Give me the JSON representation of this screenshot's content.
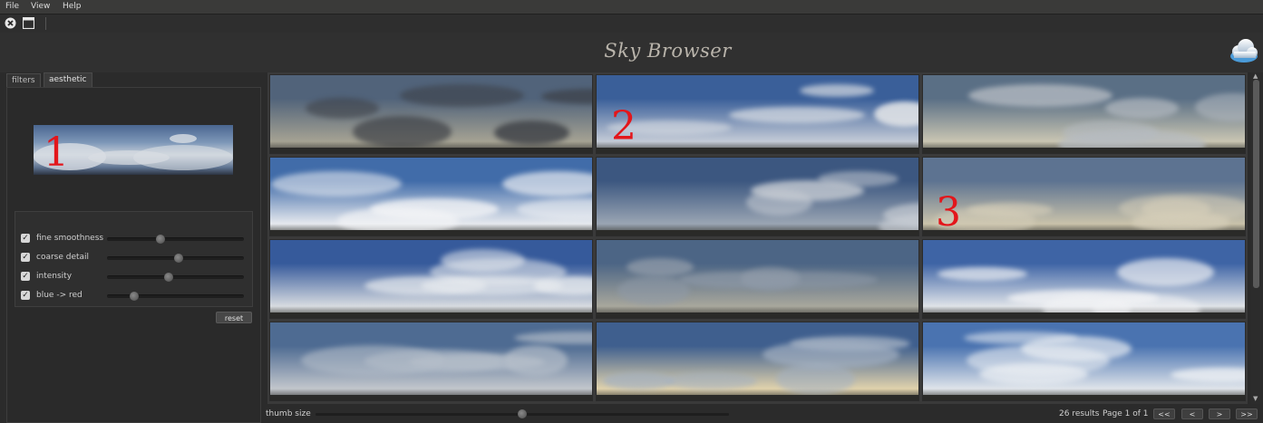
{
  "menu": {
    "file": "File",
    "view": "View",
    "help": "Help"
  },
  "toolbar": {
    "close_icon": "close-circle-icon",
    "window_icon": "window-icon"
  },
  "header": {
    "title": "Sky Browser",
    "logo_icon": "cloud-icon"
  },
  "tabs": [
    {
      "label": "filters",
      "active": false
    },
    {
      "label": "aesthetic",
      "active": true
    }
  ],
  "preview": {
    "marker": "1"
  },
  "sliders": [
    {
      "label": "fine smoothness",
      "checked": true,
      "value": 0.39
    },
    {
      "label": "coarse detail",
      "checked": true,
      "value": 0.52
    },
    {
      "label": "intensity",
      "checked": true,
      "value": 0.45
    },
    {
      "label": "blue -> red",
      "checked": true,
      "value": 0.2
    }
  ],
  "reset_label": "reset",
  "grid": {
    "markers": [
      "2",
      "3"
    ],
    "thumbnails": [
      {
        "sky": "#51637a",
        "horizon": "#a5a293",
        "cloud": "#3b3e44"
      },
      {
        "sky": "#3a5f99",
        "horizon": "#c3cad6",
        "cloud": "#dfe2e6"
      },
      {
        "sky": "#5a6f85",
        "horizon": "#c9c5b2",
        "cloud": "#b5bbc2"
      },
      {
        "sky": "#416ca9",
        "horizon": "#e6e9ee",
        "cloud": "#f3f4f6"
      },
      {
        "sky": "#3c5780",
        "horizon": "#9aa5b3",
        "cloud": "#c8cdd4"
      },
      {
        "sky": "#5d7391",
        "horizon": "#c9c2aa",
        "cloud": "#d4cdb8"
      },
      {
        "sky": "#365a9b",
        "horizon": "#d7dbe0",
        "cloud": "#e9ecef"
      },
      {
        "sky": "#4c6585",
        "horizon": "#a8a79c",
        "cloud": "#8f9aa8"
      },
      {
        "sky": "#3e64a5",
        "horizon": "#dfe3e8",
        "cloud": "#f2f3f5"
      },
      {
        "sky": "#4e6b92",
        "horizon": "#c2c6cc",
        "cloud": "#b6bfca"
      },
      {
        "sky": "#3f5f8e",
        "horizon": "#e0d2ac",
        "cloud": "#a4b1c2"
      },
      {
        "sky": "#4a73b0",
        "horizon": "#dfe4ea",
        "cloud": "#eef1f4"
      }
    ]
  },
  "footer": {
    "thumb_size_label": "thumb size",
    "thumb_size_value": 0.5,
    "results": "26 results",
    "page": "Page 1 of 1",
    "first": "<<",
    "prev": "<",
    "next": ">",
    "last": ">>"
  }
}
